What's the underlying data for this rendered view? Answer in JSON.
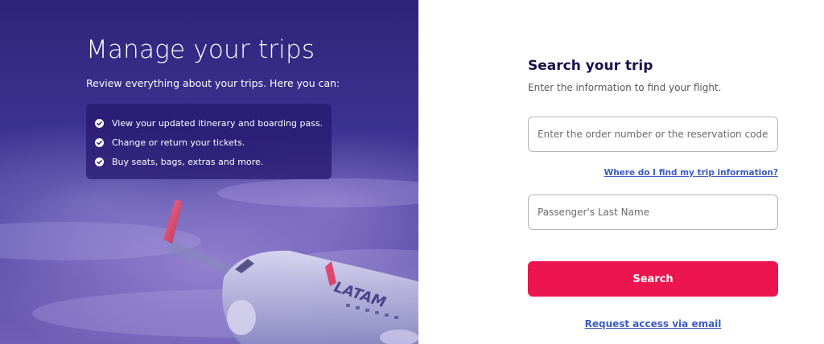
{
  "hero": {
    "title": "Manage your trips",
    "subtitle": "Review everything about your trips. Here you can:",
    "benefits": [
      {
        "icon": "check-circle-icon",
        "label": "View your updated itinerary and boarding pass."
      },
      {
        "icon": "check-circle-icon",
        "label": "Change or return your tickets."
      },
      {
        "icon": "check-circle-icon",
        "label": "Buy seats, bags, extras and more."
      }
    ],
    "logo_text": "LATAM"
  },
  "form": {
    "title": "Search your trip",
    "subtitle": "Enter the information to find your flight.",
    "order_field": {
      "placeholder": "Enter the order number or the reservation code",
      "value": ""
    },
    "help_link": "Where do I find my trip information?",
    "lastname_field": {
      "placeholder": "Passenger's Last Name",
      "value": ""
    },
    "search_label": "Search",
    "email_link": "Request access via email"
  },
  "colors": {
    "brand_navy": "#1b0f4d",
    "accent_pink": "#ec1550",
    "link_blue": "#3d5bc4",
    "hero_purple": "#3c318f"
  }
}
